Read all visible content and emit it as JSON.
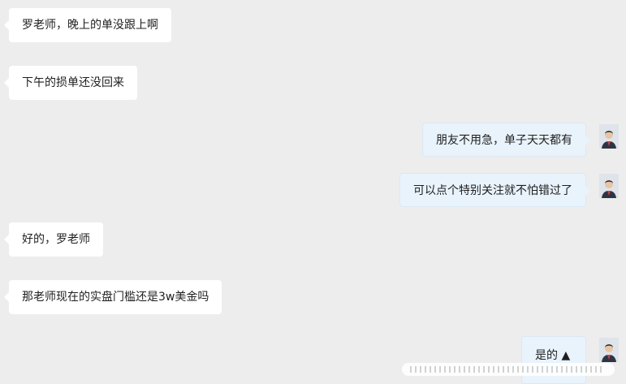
{
  "messages": [
    {
      "side": "left",
      "text": "罗老师，晚上的单没跟上啊"
    },
    {
      "side": "left",
      "text": "下午的损单还没回来"
    },
    {
      "side": "right",
      "text": "朋友不用急，单子天天都有"
    },
    {
      "side": "right",
      "text": "可以点个特别关注就不怕错过了"
    },
    {
      "side": "left",
      "text": "好的，罗老师"
    },
    {
      "side": "left",
      "text": "那老师现在的实盘门槛还是3w美金吗"
    },
    {
      "side": "right",
      "text": "是的"
    }
  ],
  "icons": {
    "avatar": "avatar-icon",
    "emoji": "thumbs-up-icon"
  }
}
